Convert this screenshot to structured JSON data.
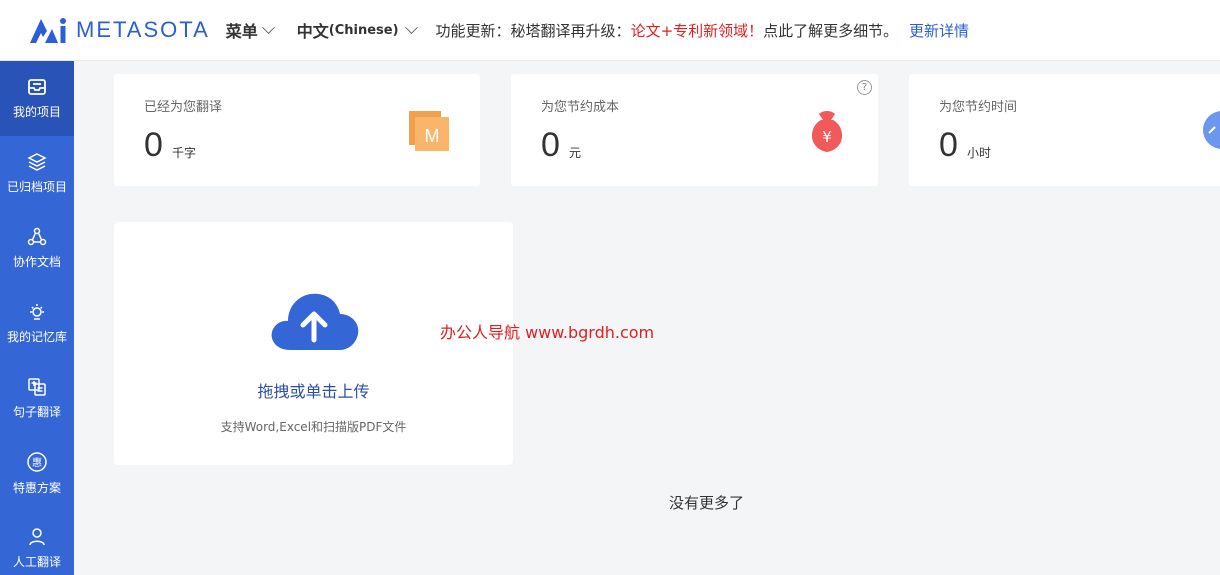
{
  "header": {
    "logo_text": "METASOTA",
    "menu_label": "菜单",
    "lang_label": "中文",
    "lang_sub": "(Chinese)",
    "notice_prefix": "功能更新：秘塔翻译再升级：",
    "notice_highlight": "论文+专利新领域！",
    "notice_suffix": "点此了解更多细节。",
    "notice_link": "更新详情"
  },
  "sidebar": {
    "items": [
      {
        "label": "我的项目",
        "icon": "inbox-icon",
        "active": true
      },
      {
        "label": "已归档项目",
        "icon": "layers-icon",
        "active": false
      },
      {
        "label": "协作文档",
        "icon": "share-network-icon",
        "active": false
      },
      {
        "label": "我的记忆库",
        "icon": "lightbulb-icon",
        "active": false
      },
      {
        "label": "句子翻译",
        "icon": "translate-doc-icon",
        "active": false
      },
      {
        "label": "特惠方案",
        "icon": "discount-badge-icon",
        "active": false
      },
      {
        "label": "人工翻译",
        "icon": "person-icon",
        "active": false
      }
    ]
  },
  "stats": [
    {
      "label": "已经为您翻译",
      "value": "0",
      "unit": "千字",
      "icon": "m-document-icon"
    },
    {
      "label": "为您节约成本",
      "value": "0",
      "unit": "元",
      "icon": "money-bag-icon",
      "help": "?"
    },
    {
      "label": "为您节约时间",
      "value": "0",
      "unit": "小时",
      "icon": "clock-icon"
    }
  ],
  "upload": {
    "title": "拖拽或单击上传",
    "hint": "支持Word,Excel和扫描版PDF文件"
  },
  "watermark": "办公人导航 www.bgrdh.com",
  "footer_text": "没有更多了",
  "colors": {
    "brand": "#3566d6",
    "sidebar_active": "#2a53b8",
    "highlight_red": "#e02020",
    "background": "#f4f5f7"
  }
}
